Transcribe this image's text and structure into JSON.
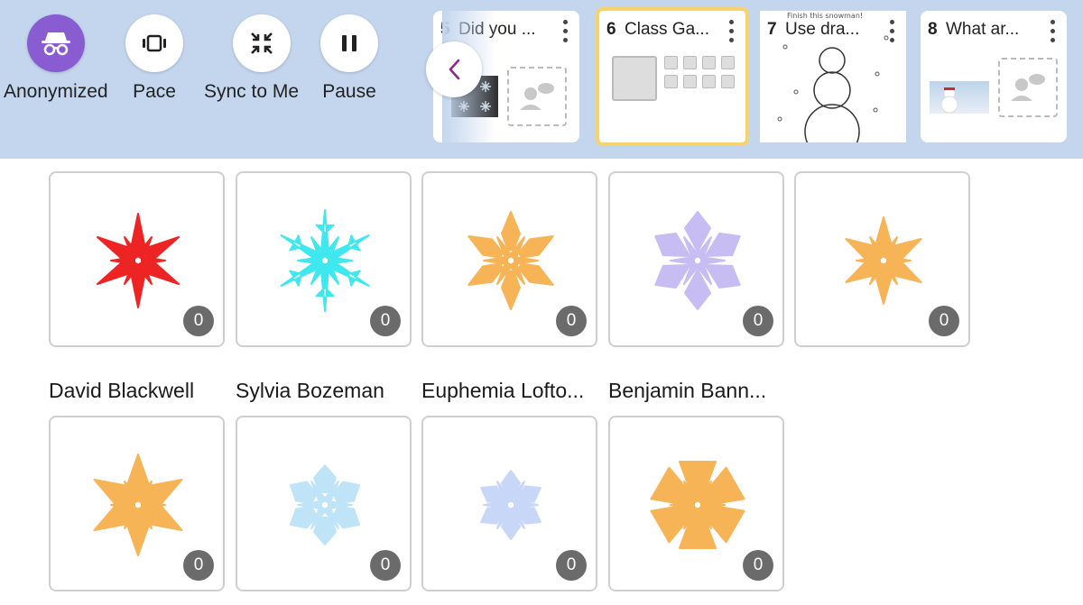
{
  "toolbar": {
    "buttons": [
      {
        "label": "Anonymized",
        "icon": "incognito-icon",
        "active": true
      },
      {
        "label": "Pace",
        "icon": "pace-icon",
        "active": false
      },
      {
        "label": "Sync to Me",
        "icon": "sync-to-me-icon",
        "active": false
      },
      {
        "label": "Pause",
        "icon": "pause-icon",
        "active": false
      }
    ]
  },
  "slides": [
    {
      "num": "5",
      "title": "Did you ..."
    },
    {
      "num": "6",
      "title": "Class Ga..."
    },
    {
      "num": "7",
      "title": "Use dra..."
    },
    {
      "num": "8",
      "title": "What ar..."
    }
  ],
  "slide7_thumbnail_text": "Finish this snowman!",
  "responses": [
    {
      "name": "",
      "count": "0",
      "color": "#ee2424"
    },
    {
      "name": "",
      "count": "0",
      "color": "#3ee8ee"
    },
    {
      "name": "",
      "count": "0",
      "color": "#f7b457"
    },
    {
      "name": "",
      "count": "0",
      "color": "#c8bdf2"
    },
    {
      "name": "",
      "count": "0",
      "color": "#f7b457"
    },
    {
      "name": "David Blackwell",
      "count": "0",
      "color": "#f7b457"
    },
    {
      "name": "Sylvia Bozeman",
      "count": "0",
      "color": "#bfe3f7"
    },
    {
      "name": "Euphemia Lofto...",
      "count": "0",
      "color": "#c8d6f7"
    },
    {
      "name": "Benjamin Bann...",
      "count": "0",
      "color": "#f7b457"
    }
  ],
  "colors": {
    "toolbar_bg": "#c3d6ee",
    "accent": "#8a5cd1",
    "selected_border": "#f7d46b"
  }
}
